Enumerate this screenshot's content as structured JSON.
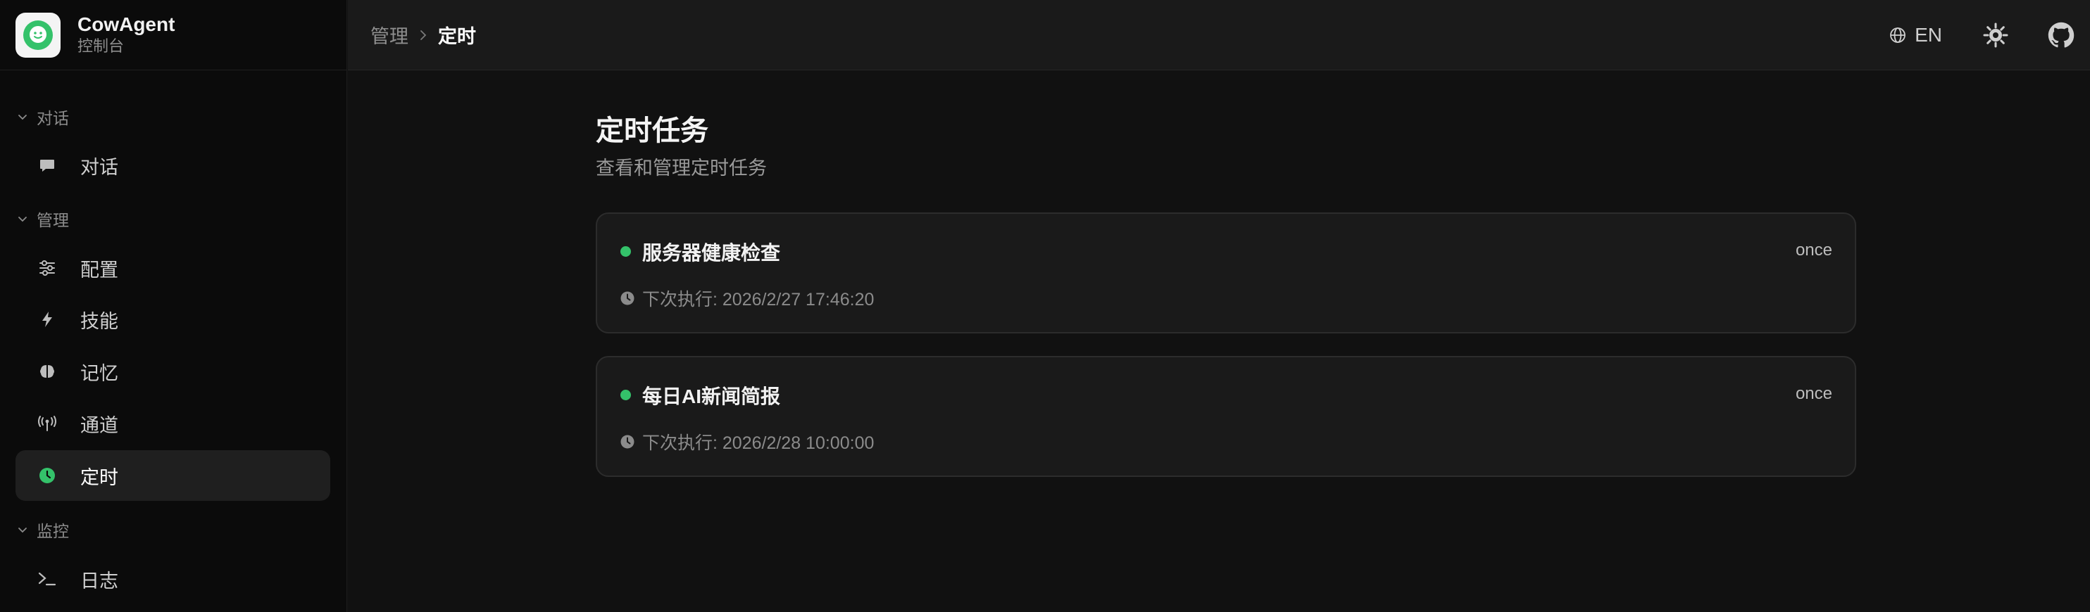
{
  "brand": {
    "title": "CowAgent",
    "subtitle": "控制台",
    "logo_icon": "chat-bubble-smile-icon",
    "accent": "#34c26a"
  },
  "sidebar": {
    "groups": [
      {
        "label": "对话",
        "items": [
          {
            "label": "对话",
            "icon": "message-icon",
            "active": false
          }
        ]
      },
      {
        "label": "管理",
        "items": [
          {
            "label": "配置",
            "icon": "sliders-icon",
            "active": false
          },
          {
            "label": "技能",
            "icon": "lightning-icon",
            "active": false
          },
          {
            "label": "记忆",
            "icon": "brain-icon",
            "active": false
          },
          {
            "label": "通道",
            "icon": "antenna-icon",
            "active": false
          },
          {
            "label": "定时",
            "icon": "clock-icon",
            "active": true
          }
        ]
      },
      {
        "label": "监控",
        "items": [
          {
            "label": "日志",
            "icon": "terminal-icon",
            "active": false
          }
        ]
      }
    ]
  },
  "topbar": {
    "breadcrumb": {
      "parent": "管理",
      "current": "定时"
    },
    "lang_label": "EN"
  },
  "main": {
    "title": "定时任务",
    "subtitle": "查看和管理定时任务",
    "tasks": [
      {
        "name": "服务器健康检查",
        "tag": "once",
        "next_run": "下次执行: 2026/2/27 17:46:20",
        "status_color": "#34c26a"
      },
      {
        "name": "每日AI新闻简报",
        "tag": "once",
        "next_run": "下次执行: 2026/2/28 10:00:00",
        "status_color": "#34c26a"
      }
    ]
  }
}
